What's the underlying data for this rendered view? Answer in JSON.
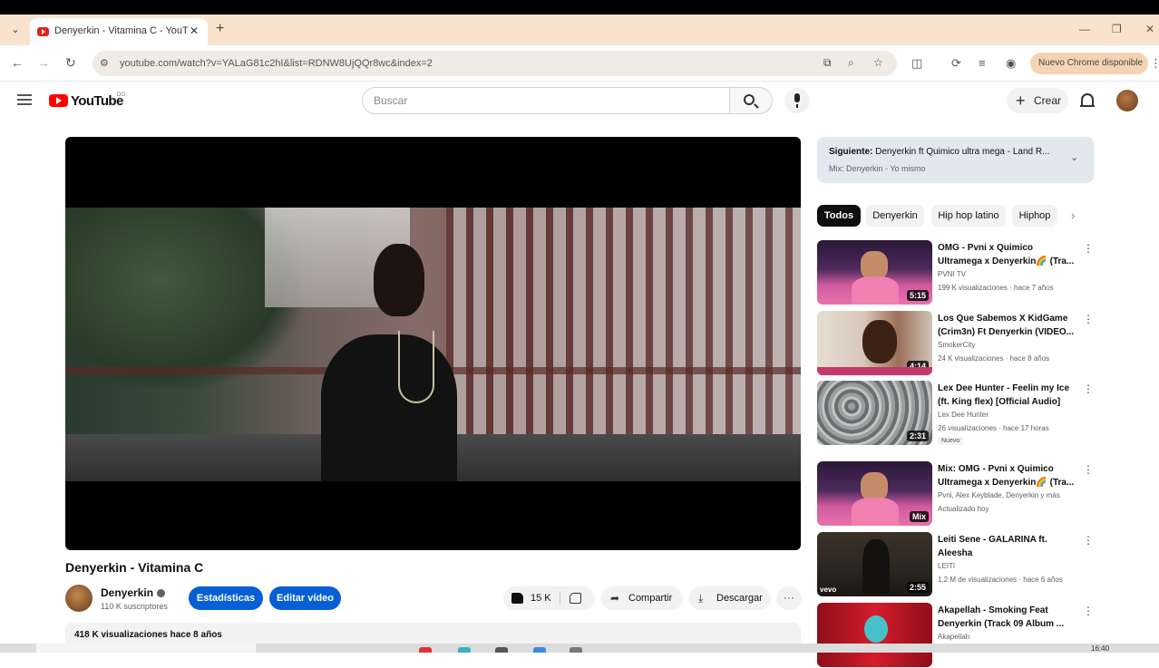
{
  "browser": {
    "tab_title": "Denyerkin - Vitamina C - YouTube",
    "tab_close": "✕",
    "new_tab": "+",
    "url": "youtube.com/watch?v=YALaG81c2hI&list=RDNW8UjQQr8wc&index=2",
    "update_label": "Nuevo Chrome disponible",
    "window_controls": [
      "—",
      "❐",
      "✕"
    ]
  },
  "youtube": {
    "logo_text": "YouTube",
    "logo_sup": "DO",
    "search_placeholder": "Buscar",
    "create_label": "Crear"
  },
  "video": {
    "title": "Denyerkin - Vitamina C",
    "channel": "Denyerkin",
    "subscribers": "110 K suscriptores",
    "stats_button": "Estadísticas",
    "edit_button": "Editar vídeo",
    "likes": "15 K",
    "share_label": "Compartir",
    "download_label": "Descargar",
    "more_label": "···",
    "views_and_date": "418 K visualizaciones  hace 8 años"
  },
  "sidebar": {
    "next_label": "Siguiente:",
    "next_title": "Denyerkin ft Quimico ultra mega - Land R...",
    "mix_sub": "Mix: Denyerkin - Yo mismo",
    "chips": [
      "Todos",
      "Denyerkin",
      "Hip hop latino",
      "Hiphop"
    ],
    "recommendations": [
      {
        "title": "OMG - Pvni x Quimico Ultramega x Denyerkin🌈 (Tra...",
        "channel": "PVNI TV",
        "meta": "199 K visualizaciones · hace 7 años",
        "duration": "5:15",
        "badge": "",
        "thumb": "pink"
      },
      {
        "title": "Los Que Sabemos X KidGame (Crim3n) Ft Denyerkin (VIDEO...",
        "channel": "SmokerCity",
        "meta": "24 K visualizaciones · hace 8 años",
        "duration": "4:14",
        "badge": "",
        "thumb": "tan"
      },
      {
        "title": "Lex Dee Hunter - Feelin my Ice (ft. King flex) [Official Audio]",
        "channel": "Lex Dee Hunter",
        "meta": "26 visualizaciones · hace 17 horas",
        "duration": "2:31",
        "badge": "Nuevo",
        "thumb": "gray"
      },
      {
        "title": "Mix: OMG - Pvni x Quimico Ultramega x Denyerkin🌈 (Tra...",
        "channel": "Pvni, Alex Keyblade, Denyerkin y más",
        "meta": "Actualizado hoy",
        "duration": "Mix",
        "badge": "",
        "thumb": "pink"
      },
      {
        "title": "Leiti Sene - GALARINA ft. Aleesha",
        "channel": "LEITI",
        "meta": "1,2 M de visualizaciones · hace 6 años",
        "duration": "2:55",
        "badge": "",
        "thumb": "dark"
      },
      {
        "title": "Akapellah - Smoking Feat Denyerkin (Track 09 Album ...",
        "channel": "Akapellah",
        "meta": "",
        "duration": "",
        "badge": "",
        "thumb": "red"
      }
    ]
  },
  "taskbar": {
    "time": "16:40"
  },
  "colors": {
    "accent_blue": "#065fd4",
    "youtube_red": "#ff0000",
    "tabstrip": "#f9e3cf"
  }
}
